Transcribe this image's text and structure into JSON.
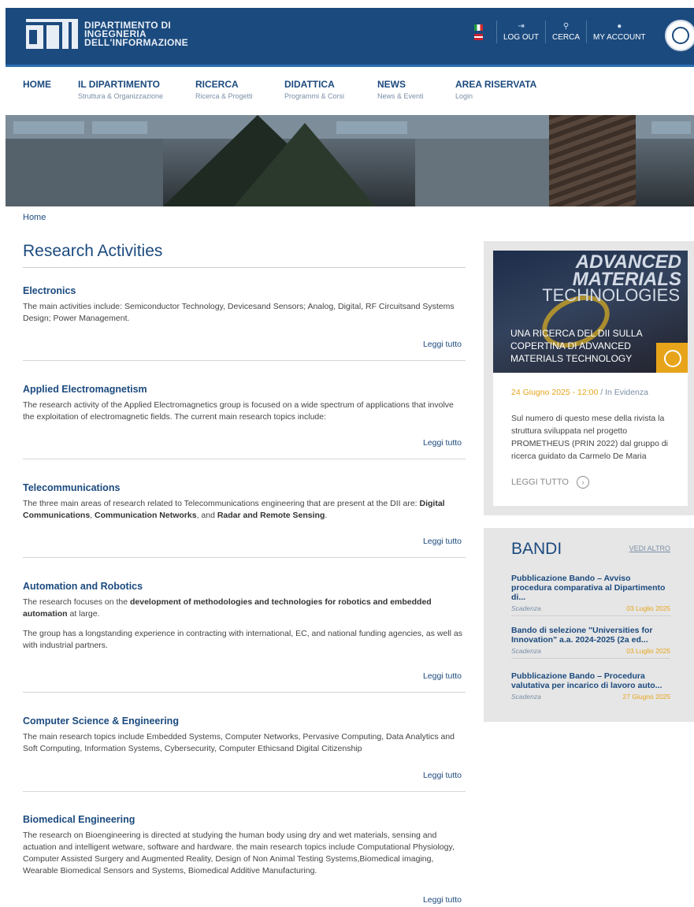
{
  "header": {
    "logo_text_lines": [
      "DIPARTIMENTO DI",
      "INGEGNERIA",
      "DELL'INFORMAZIONE"
    ],
    "links": [
      {
        "label": "LOG OUT",
        "icon": "logout-icon",
        "glyph": "⇥"
      },
      {
        "label": "CERCA",
        "icon": "search-icon",
        "glyph": "⚲"
      },
      {
        "label": "MY ACCOUNT",
        "icon": "user-icon",
        "glyph": "●"
      }
    ]
  },
  "nav": [
    {
      "title": "HOME",
      "subtitle": ""
    },
    {
      "title": "IL DIPARTIMENTO",
      "subtitle": "Struttura & Organizzazione"
    },
    {
      "title": "RICERCA",
      "subtitle": "Ricerca & Progetti"
    },
    {
      "title": "DIDATTICA",
      "subtitle": "Programmi & Corsi"
    },
    {
      "title": "NEWS",
      "subtitle": "News & Eventi"
    },
    {
      "title": "AREA RISERVATA",
      "subtitle": "Login"
    }
  ],
  "breadcrumb": "Home",
  "page_title": "Research Activities",
  "read_more": "Leggi tutto",
  "sections": [
    {
      "title": "Electronics",
      "paragraphs": [
        "The main activities include: Semiconductor Technology, Devicesand Sensors; Analog, Digital, RF Circuitsand Systems Design; Power Management."
      ]
    },
    {
      "title": "Applied Electromagnetism",
      "paragraphs": [
        "The research activity of the Applied Electromagnetics group is focused on a wide spectrum of applications that involve the exploitation of electromagnetic fields. The current main research topics include:"
      ]
    },
    {
      "title": "Telecommunications",
      "paragraphs": [
        "The three main areas of research related to Telecommunications engineering that are present at the DII are: Digital Communications, Communication Networks, and Radar and Remote Sensing."
      ]
    },
    {
      "title": "Automation and Robotics",
      "paragraphs": [
        "The research focuses on the development of methodologies and technologies for robotics and embedded automation at large.",
        "The group has a longstanding experience in contracting with international, EC, and national funding agencies, as well as with industrial partners."
      ]
    },
    {
      "title": "Computer Science & Engineering",
      "paragraphs": [
        "The main research topics include Embedded Systems, Computer Networks, Pervasive Computing, Data Analytics and Soft Computing, Information Systems, Cybersecurity, Computer Ethicsand Digital Citizenship"
      ]
    },
    {
      "title": "Biomedical Engineering",
      "paragraphs": [
        "The research on Bioengineering is directed at studying the human body using dry and wet materials, sensing and actuation and intelligent wetware, software and hardware. the main research topics include Computational Physiology, Computer Assisted Surgery and Augmented Reality, Design of Non Animal Testing Systems,Biomedical imaging, Wearable Biomedical Sensors and Systems, Biomedical Additive Manufacturing."
      ]
    }
  ],
  "news": {
    "image_heading_1": "ADVANCED",
    "image_heading_2": "MATERIALS",
    "image_heading_3": "TECHNOLOGIES",
    "caption": "UNA RICERCA DEL DII SULLA COPERTINA DI ADVANCED MATERIALS TECHNOLOGY",
    "date": "24 Giugno 2025 - 12:00",
    "category": " / In Evidenza",
    "description": "Sul numero di questo mese della rivista la struttura sviluppata nel progetto PROMETHEUS (PRIN 2022) dal gruppo di ricerca guidato da Carmelo De Maria",
    "more_label": "LEGGI TUTTO"
  },
  "bandi": {
    "title": "BANDI",
    "more_label": "VEDI ALTRO",
    "items": [
      {
        "title": "Pubblicazione Bando – Avviso procedura comparativa al Dipartimento di...",
        "label": "Scadenza",
        "date": "03 Luglio 2025"
      },
      {
        "title": "Bando di selezione \"Universities for Innovation\" a.a. 2024-2025 (2a ed...",
        "label": "Scadenza",
        "date": "03 Luglio 2025"
      },
      {
        "title": "Pubblicazione Bando – Procedura valutativa per incarico di lavoro auto...",
        "label": "Scadenza",
        "date": "27 Giugno 2025"
      }
    ]
  }
}
